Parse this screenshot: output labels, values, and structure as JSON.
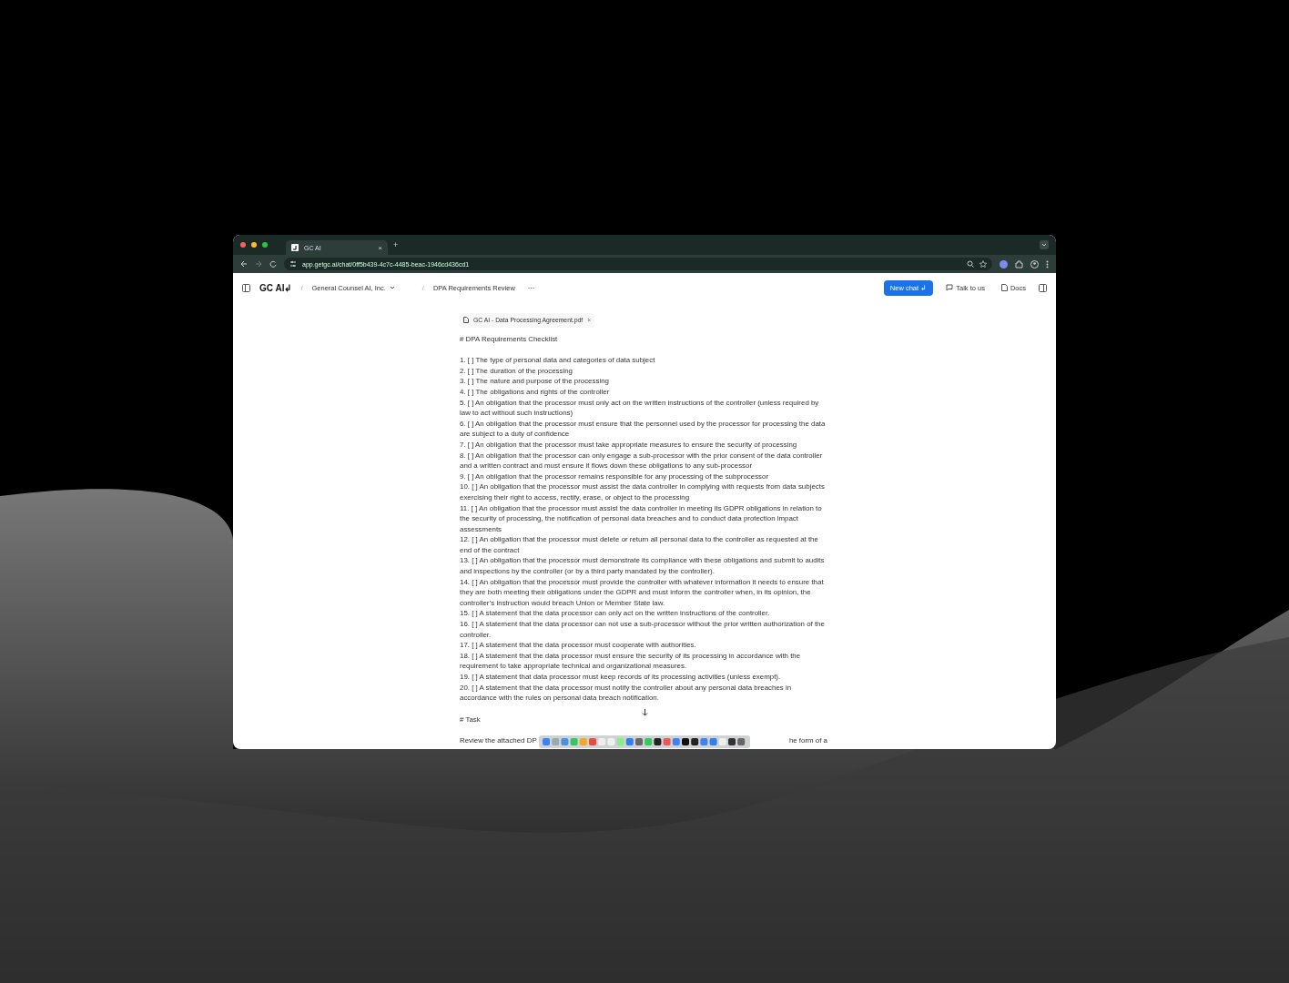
{
  "browser": {
    "tab": {
      "title": "GC AI",
      "close": "×"
    },
    "new_tab": "+",
    "url": "app.getgc.ai/chat/0ff5b439-4c7c-4485-beac-1946cd436cd1"
  },
  "header": {
    "logo": "GC AI↲",
    "breadcrumbs": [
      {
        "separator": "/",
        "label": "General Counsel AI, Inc.",
        "dropdown": true
      },
      {
        "separator": "/",
        "label": "DPA Requirements Review",
        "dropdown": false
      }
    ],
    "more": "···",
    "new_chat": "New chat ↲",
    "talk": "Talk to us",
    "docs": "Docs"
  },
  "attachment": {
    "name": "GC AI - Data Processing Agreement.pdf",
    "remove": "×"
  },
  "message": {
    "heading": "# DPA Requirements Checklist",
    "items": [
      "1. [ ] The type of personal data and categories of data subject",
      "2. [ ] The duration of the processing",
      "3. [ ] The nature and purpose of the processing",
      "4. [ ] The obligations and rights of the controller",
      "5. [ ] An obligation that the processor must only act on the written instructions of the controller (unless required by law to act without such instructions)",
      "6. [ ] An obligation that the processor must ensure that the personnel used by the processor for processing the data are subject to a duty of confidence",
      "7. [ ] An obligation that the processor must take appropriate measures to ensure the security of processing",
      "8. [ ] An obligation that the processor can only engage a sub-processor with the prior consent of the data controller and a written contract and must ensure it flows down these obligations to any sub-processor",
      "9. [ ] An obligation that the processor remains responsible for any processing of the subprocessor",
      "10. [ ] An obligation that the processor must assist the data controller in complying with requests from data subjects exercising their right to access, rectify, erase, or object to the processing",
      "11. [ ] An obligation that the processor must assist the data controller in meeting its GDPR obligations in relation to the security of processing, the notification of personal data breaches and to conduct data protection impact assessments",
      "12. [ ] An obligation that the processor must delete or return all personal data to the controller as requested at the end of the contract",
      "13. [ ] An obligation that the processor must demonstrate its compliance with these obligations and submit to audits and inspections by the controller (or by a third party mandated by the controller).",
      "14. [ ] An obligation that the processor must provide the controller with whatever information it needs to ensure that they are both meeting their obligations under the GDPR and must inform the controller when, in its opinion, the controller’s instruction would breach Union or Member State law.",
      "15. [ ] A statement that the data processor can only act on the written instructions of the controller.",
      "16. [ ] A statement that the data processor can not use a sub-processor without the prior written authorization of the controller.",
      "17. [ ] A statement that the data processor must cooperate with authorities.",
      "18. [ ] A statement that the data processor must ensure the security of its processing in accordance with the requirement to take appropriate technical and organizational measures.",
      "19. [ ] A statement that data processor must keep records of its processing activities (unless exempt).",
      "20. [ ] A statement that the data processor must notify the controller about any personal data breaches in accordance with the rules on personal data breach notification."
    ],
    "task_heading": "# Task",
    "task_start": "Review the attached DP",
    "task_end": "he form of a"
  }
}
